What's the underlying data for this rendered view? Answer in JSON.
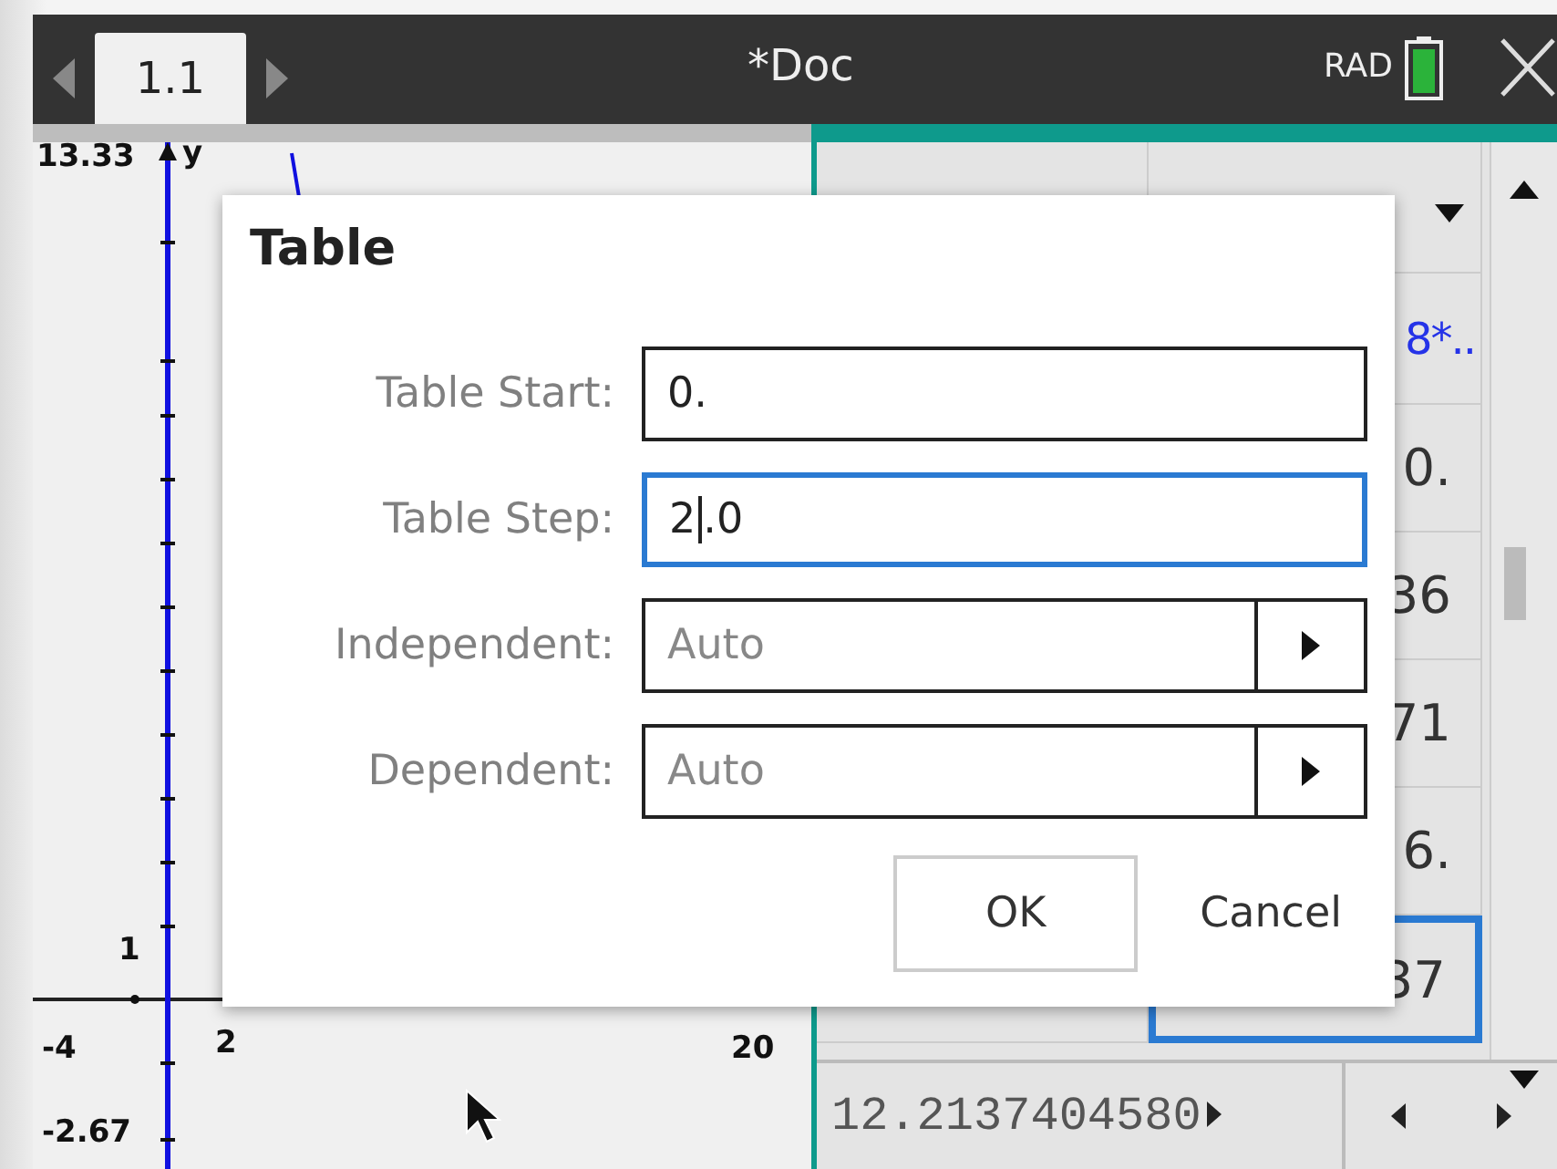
{
  "title_bar": {
    "page_tab": "1.1",
    "document": "*Doc",
    "angle_mode": "RAD"
  },
  "graph": {
    "y_max": "13.33",
    "y_axis_label": "y",
    "y_tick_label": "1",
    "x_min": "-4",
    "x_tick_label": "2",
    "x_max": "20",
    "y_min": "-2.67"
  },
  "table": {
    "formula": "8*..",
    "rows": [
      {
        "value": "0.",
        "selected": false
      },
      {
        "value": "36",
        "selected": false
      },
      {
        "value": "71",
        "selected": false
      },
      {
        "value": "6.",
        "selected": false
      },
      {
        "value": "37",
        "selected": true
      }
    ],
    "entry_line": "12.2137404580"
  },
  "dialog": {
    "title": "Table",
    "fields": [
      {
        "label": "Table Start:",
        "kind": "input",
        "value": "0.",
        "focused": false
      },
      {
        "label": "Table Step:",
        "kind": "input",
        "value": "2.0",
        "focused": true
      },
      {
        "label": "Independent:",
        "kind": "select",
        "value": "Auto",
        "focused": false
      },
      {
        "label": "Dependent:",
        "kind": "select",
        "value": "Auto",
        "focused": false
      }
    ],
    "buttons": [
      {
        "label": "OK",
        "kind": "boxed"
      },
      {
        "label": "Cancel",
        "kind": "plain"
      }
    ]
  }
}
